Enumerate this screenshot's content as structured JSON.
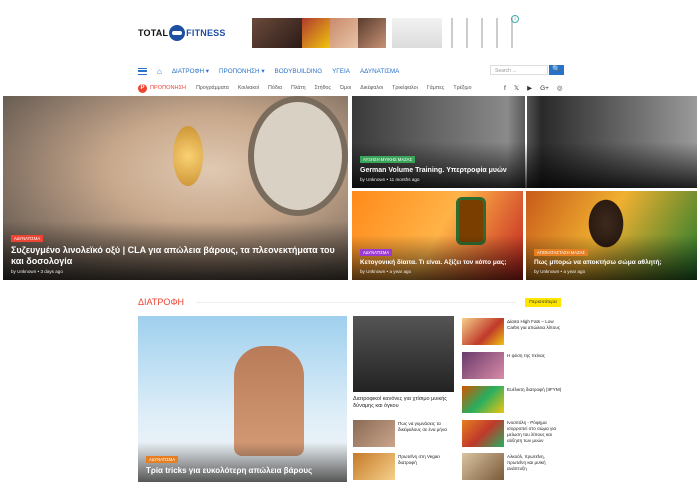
{
  "header": {
    "logo_left": "TOTAL",
    "logo_right": "FITNESS"
  },
  "nav": {
    "items": [
      "ΔΙΑΤΡΟΦΗ ▾",
      "ΠΡΟΠΟΝΗΣΗ ▾",
      "BODYBUILDING",
      "ΥΓΕΙΑ",
      "ΑΔΥΝΑΤΙΣΜΑ"
    ],
    "search_placeholder": "Search ...",
    "search_button": "🔍"
  },
  "subnav": {
    "label": "ΠΡΟΠΟΝΗΣΗ",
    "items": [
      "Προγράμματα",
      "Κοιλιακοί",
      "Πόδια",
      "Πλάτη",
      "Στήθος",
      "Ώμοι",
      "Δικέφαλοι",
      "Τρικέφαλοι",
      "Γάμπες",
      "Τρέξιμο"
    ],
    "social": [
      "f",
      "𝕏",
      "▶",
      "G+",
      "◎"
    ]
  },
  "hero": {
    "main": {
      "tag": "ΑΔΥΝΑΤΙΣΜΑ",
      "title": "Συζευγμένο λινολεϊκό οξύ | CLA για απώλεια βάρους, τα πλεονεκτήματα του και δοσολογία",
      "meta": "by Unknown  •  3 days ago",
      "tag_color": "#e43"
    },
    "t1": {
      "tag": "ΑΥΞΗΣΗ ΜΥΙΚΗΣ ΜΑΖΑΣ",
      "title": "German Volume Training. Υπερτροφία μυών",
      "meta": "by Unknown  •  11 months ago",
      "tag_color": "#3aa55a"
    },
    "t2": {
      "tag": "ΑΔΥΝΑΤΙΣΜΑ",
      "title": "Κετογονική δίαιτα. Τι είναι. Αξίζει τον κόπο μας;",
      "meta": "by Unknown  •  a year ago",
      "tag_color": "#9b3bd1"
    },
    "t3": {
      "tag": "ΑΠΟΚΑΤΑΣΤΑΣΗ ΜΑΖΑΣ",
      "title": "Πως μπορώ να αποκτήσω σώμα αθλητή;",
      "meta": "by Unknown  •  a year ago",
      "tag_color": "#e67e22"
    }
  },
  "section": {
    "title": "ΔΙΑΤΡΟΦΗ",
    "more": "Περισσότερα",
    "big": {
      "tag": "ΑΔΥΝΑΤΙΣΜΑ",
      "title": "Τρία tricks για ευκολότερη απώλεια βάρους"
    },
    "mid": {
      "title": "Διατροφικοί κανόνες για χτίσιμο μυικής δύναμης και όγκου"
    },
    "small": [
      {
        "title": "Πως να γυμνάσεις τα δικέφαλους σε ένα μήνα"
      },
      {
        "title": "Πρωτεΐνη στη Vegan διατροφή"
      }
    ],
    "side": [
      {
        "title": "Δίαιτα High Fats – Low Carbs για απώλεια λίπους"
      },
      {
        "title": "Η φύση της πείνας"
      },
      {
        "title": "Ευέλικτη διατροφή (IIFYM)"
      },
      {
        "title": "Ινοσιτόλη - Ρόφημα ισορροπεί στο σώμα για μείωση του λίπους και αύξηση των μυών"
      },
      {
        "title": "Αλκοόλ, πρωτεΐνη, πρωτεΐνη και μυϊκή ανάπτυξη"
      }
    ]
  }
}
